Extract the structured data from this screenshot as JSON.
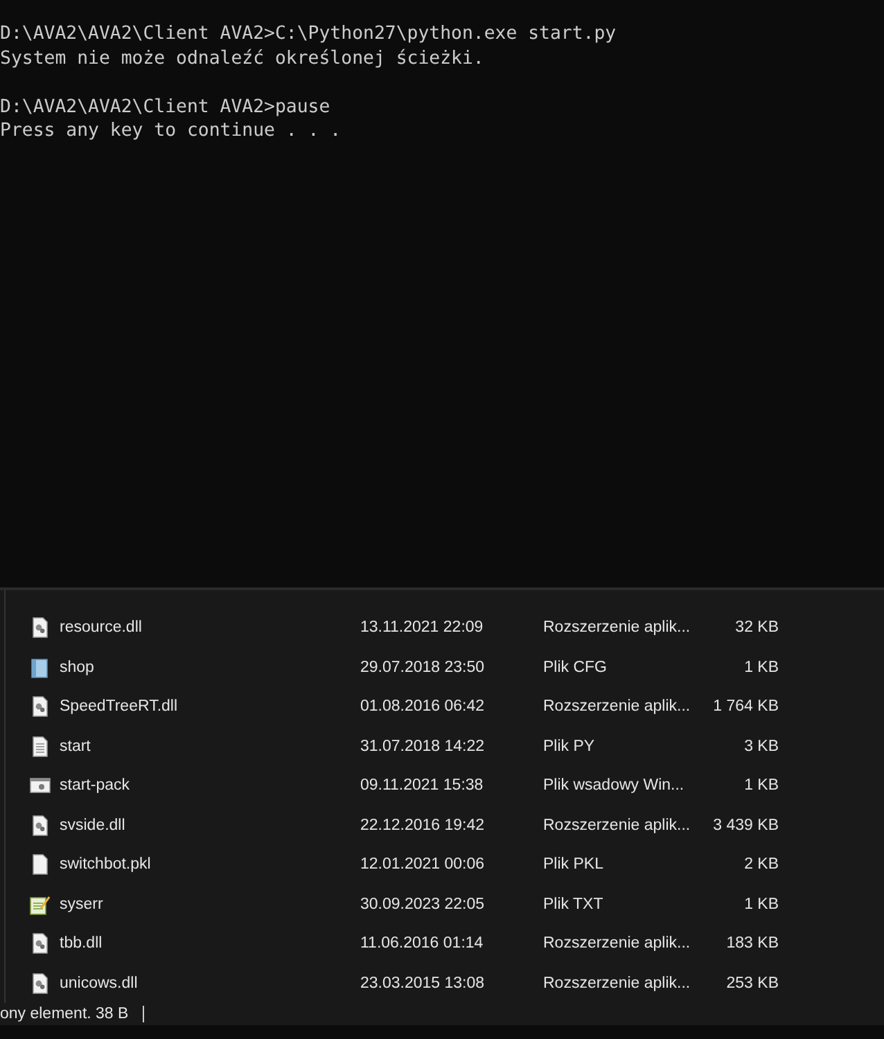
{
  "console": {
    "blocks": [
      {
        "lines": [
          "D:\\AVA2\\AVA2\\Client AVA2>C:\\Python27\\python.exe start.py",
          "System nie może odnaleźć określonej ścieżki."
        ]
      },
      {
        "lines": [
          "D:\\AVA2\\AVA2\\Client AVA2>pause",
          "Press any key to continue . . ."
        ]
      }
    ]
  },
  "files": [
    {
      "name": "resource.dll",
      "kind": "dll",
      "date": "13.11.2021 22:09",
      "type": "Rozszerzenie aplik...",
      "size": "32 KB"
    },
    {
      "name": "shop",
      "kind": "cfg",
      "date": "29.07.2018 23:50",
      "type": "Plik CFG",
      "size": "1 KB"
    },
    {
      "name": "SpeedTreeRT.dll",
      "kind": "dll",
      "date": "01.08.2016 06:42",
      "type": "Rozszerzenie aplik...",
      "size": "1 764 KB"
    },
    {
      "name": "start",
      "kind": "text",
      "date": "31.07.2018 14:22",
      "type": "Plik PY",
      "size": "3 KB"
    },
    {
      "name": "start-pack",
      "kind": "batch",
      "date": "09.11.2021 15:38",
      "type": "Plik wsadowy Win...",
      "size": "1 KB"
    },
    {
      "name": "svside.dll",
      "kind": "dll",
      "date": "22.12.2016 19:42",
      "type": "Rozszerzenie aplik...",
      "size": "3 439 KB"
    },
    {
      "name": "switchbot.pkl",
      "kind": "blank",
      "date": "12.01.2021 00:06",
      "type": "Plik PKL",
      "size": "2 KB"
    },
    {
      "name": "syserr",
      "kind": "notepad",
      "date": "30.09.2023 22:05",
      "type": "Plik TXT",
      "size": "1 KB"
    },
    {
      "name": "tbb.dll",
      "kind": "dll",
      "date": "11.06.2016 01:14",
      "type": "Rozszerzenie aplik...",
      "size": "183 KB"
    },
    {
      "name": "unicows.dll",
      "kind": "dll",
      "date": "23.03.2015 13:08",
      "type": "Rozszerzenie aplik...",
      "size": "253 KB"
    }
  ],
  "status_bar": {
    "text": "ony element. 38 B"
  }
}
